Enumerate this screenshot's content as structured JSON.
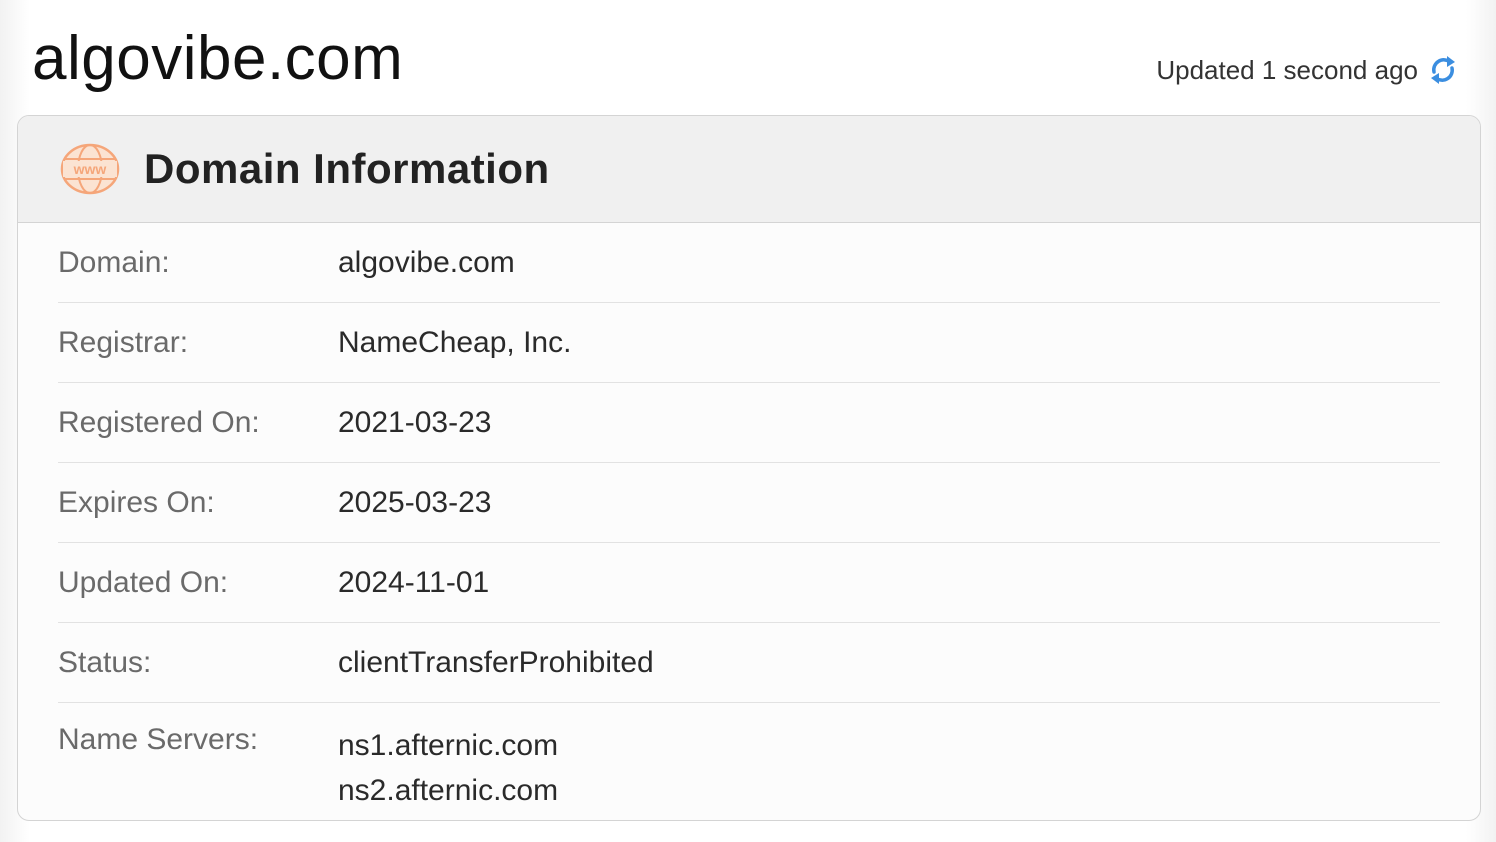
{
  "header": {
    "site_title": "algovibe.com",
    "updated_text": "Updated 1 second ago",
    "refresh_icon": "refresh-icon"
  },
  "card": {
    "title": "Domain Information",
    "icon": "www-icon",
    "icon_text": "www",
    "accent_color": "#f5a67a",
    "rows": [
      {
        "label": "Domain:",
        "value": "algovibe.com"
      },
      {
        "label": "Registrar:",
        "value": "NameCheap, Inc."
      },
      {
        "label": "Registered On:",
        "value": "2021-03-23"
      },
      {
        "label": "Expires On:",
        "value": "2025-03-23"
      },
      {
        "label": "Updated On:",
        "value": "2024-11-01"
      },
      {
        "label": "Status:",
        "value": "clientTransferProhibited"
      },
      {
        "label": "Name Servers:",
        "values": [
          "ns1.afternic.com",
          "ns2.afternic.com"
        ]
      }
    ]
  }
}
